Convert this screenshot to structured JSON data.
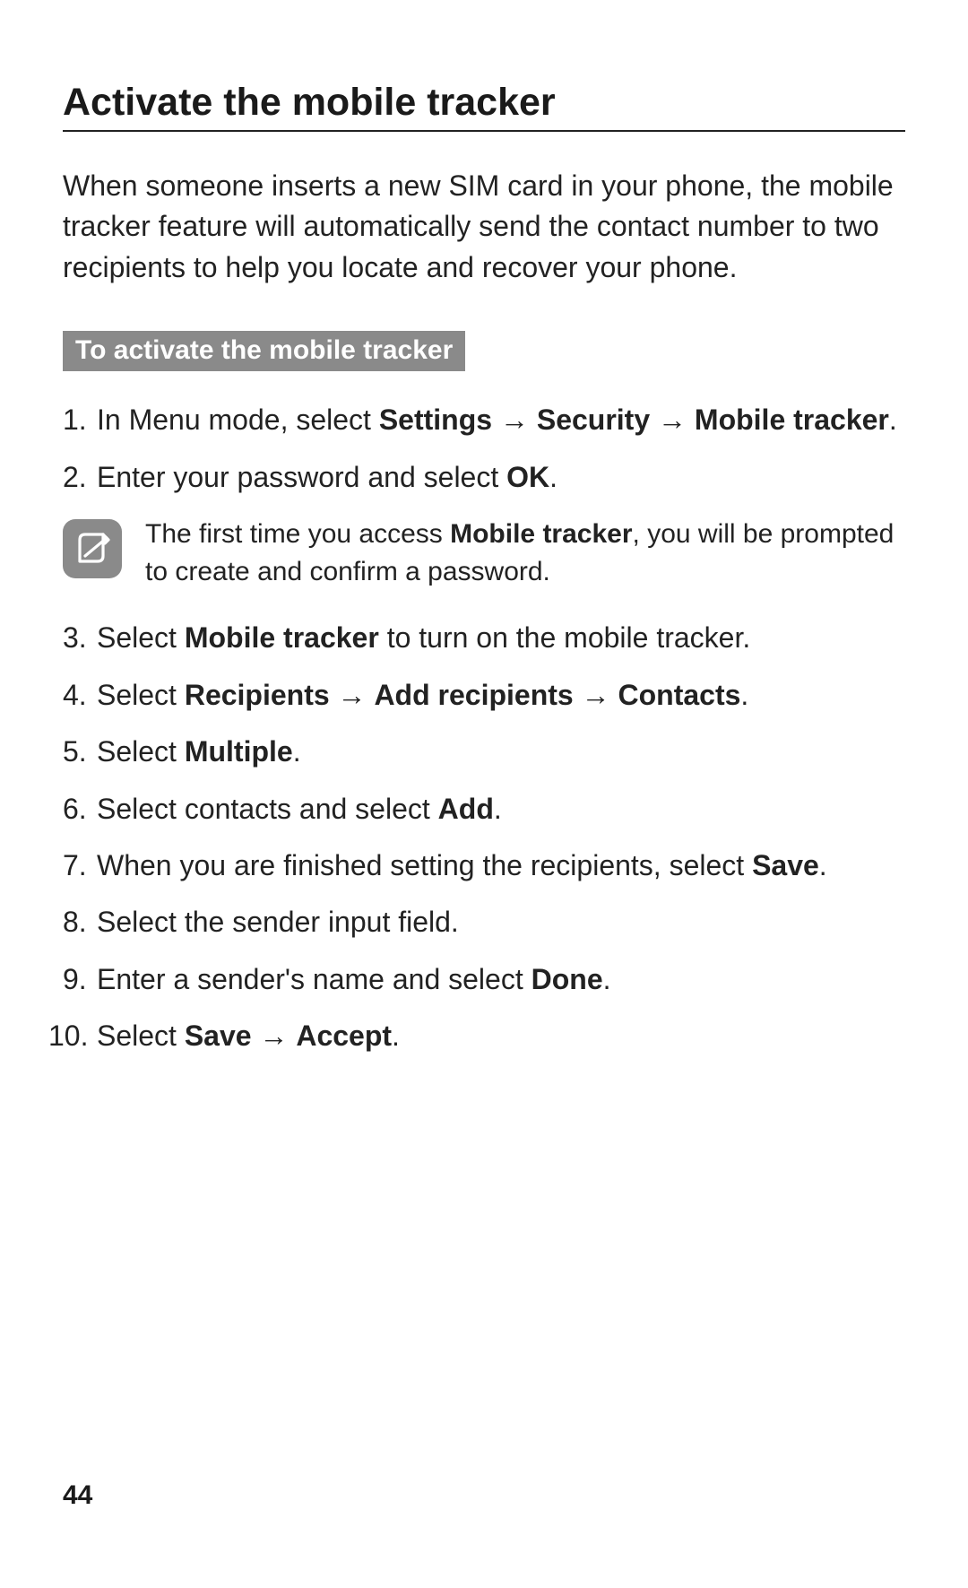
{
  "title": "Activate the mobile tracker",
  "intro": "When someone inserts a new SIM card in your phone, the mobile tracker feature will automatically send the contact number to two recipients to help you locate and recover your phone.",
  "sub_heading": "To activate the mobile tracker",
  "steps": {
    "s1": {
      "pre": "In Menu mode, select ",
      "b1": "Settings",
      "arrow1": " → ",
      "b2": "Security",
      "arrow2": " → ",
      "b3": "Mobile tracker",
      "post": "."
    },
    "s2": {
      "pre": "Enter your password and select ",
      "b1": "OK",
      "post": "."
    },
    "note": {
      "pre": "The first time you access ",
      "b1": "Mobile tracker",
      "post": ", you will be prompted to create and confirm a password."
    },
    "s3": {
      "pre": "Select ",
      "b1": "Mobile tracker",
      "post": " to turn on the mobile tracker."
    },
    "s4": {
      "pre": "Select ",
      "b1": "Recipients",
      "arrow1": " → ",
      "b2": "Add recipients",
      "arrow2": " → ",
      "b3": "Contacts",
      "post": "."
    },
    "s5": {
      "pre": "Select ",
      "b1": "Multiple",
      "post": "."
    },
    "s6": {
      "pre": "Select contacts and select ",
      "b1": "Add",
      "post": "."
    },
    "s7": {
      "pre": "When you are finished setting the recipients, select ",
      "b1": "Save",
      "post": "."
    },
    "s8": {
      "text": "Select the sender input field."
    },
    "s9": {
      "pre": "Enter a sender's name and select ",
      "b1": "Done",
      "post": "."
    },
    "s10": {
      "pre": "Select ",
      "b1": "Save",
      "arrow1": " → ",
      "b2": "Accept",
      "post": "."
    }
  },
  "page_number": "44"
}
